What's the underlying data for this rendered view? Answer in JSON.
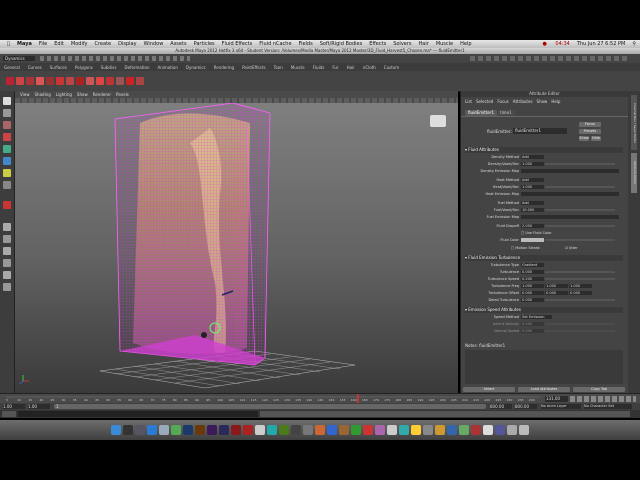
{
  "menubar": {
    "app": "Maya",
    "items": [
      "File",
      "Edit",
      "Modify",
      "Create",
      "Display",
      "Window",
      "Assets",
      "Particles",
      "Fluid Effects",
      "Fluid nCache",
      "Fields",
      "Soft/Rigid Bodies",
      "Effects",
      "Solvers",
      "Hair",
      "Muscle",
      "Help"
    ],
    "clock": "Thu Jun 27 6:52 PM",
    "battery": "04:34"
  },
  "window_title": "Autodesk Maya 2012 Hotfix 3 x64 - Student Version: /Volumes/Media Master/Maya 2012 Master/3D_Fluid_Harvest5_Chosen.ma* --- fluidEmitter1",
  "menu_set": "Dynamics",
  "shelf_tabs": [
    "General",
    "Curves",
    "Surfaces",
    "Polygons",
    "Subdivs",
    "Deformation",
    "Animation",
    "Dynamics",
    "Rendering",
    "PaintEffects",
    "Toon",
    "Muscle",
    "Fluids",
    "Fur",
    "Hair",
    "nCloth",
    "Custom"
  ],
  "viewport_menu": [
    "View",
    "Shading",
    "Lighting",
    "Show",
    "Renderer",
    "Panels"
  ],
  "attribute_editor": {
    "header": "Attribute Editor",
    "menu": [
      "List",
      "Selected",
      "Focus",
      "Attributes",
      "Show",
      "Help"
    ],
    "tabs": [
      "fluidEmitter1",
      "time1"
    ],
    "node_label": "fluidEmitter:",
    "node_value": "fluidEmitter1",
    "buttons": {
      "focus": "Focus",
      "presets": "Presets",
      "show": "Show",
      "hide": "Hide"
    },
    "sections": {
      "fluid": "Fluid Attributes",
      "turbulence": "Fluid Emission Turbulence",
      "speed": "Emission Speed Attributes"
    },
    "fluid_rows": [
      {
        "label": "Density Method",
        "value": "Add"
      },
      {
        "label": "Density/Voxel/Sec",
        "value": "1.000"
      },
      {
        "label": "Density Emission Map",
        "value": ""
      },
      {
        "label": "Heat Method",
        "value": "Add"
      },
      {
        "label": "Heat/Voxel/Sec",
        "value": "1.000"
      },
      {
        "label": "Heat Emission Map",
        "value": ""
      },
      {
        "label": "Fuel Method",
        "value": "Add"
      },
      {
        "label": "Fuel/Voxel/Sec",
        "value": "10.000"
      },
      {
        "label": "Fuel Emission Map",
        "value": ""
      },
      {
        "label": "Fluid Dropoff",
        "value": "2.000"
      }
    ],
    "use_fluid_color": "Use Fluid Color",
    "fluid_color_label": "Fluid Color",
    "motion_streak": "Motion Streak",
    "jitter": "Jitter",
    "turb_rows": [
      {
        "label": "Turbulence Type",
        "value": "Gradient"
      },
      {
        "label": "Turbulence",
        "value": "0.000"
      },
      {
        "label": "Turbulence Speed",
        "value": "0.200"
      },
      {
        "label": "Turbulence Freq",
        "value": "1.000",
        "v2": "1.000",
        "v3": "1.000"
      },
      {
        "label": "Turbulence Offset",
        "value": "0.000",
        "v2": "0.000",
        "v3": "0.000"
      },
      {
        "label": "Detail Turbulence",
        "value": "0.000"
      }
    ],
    "speed_rows": [
      {
        "label": "Speed Method",
        "value": "Set Emission"
      },
      {
        "label": "Inherit Velocity",
        "value": "0.000"
      },
      {
        "label": "Normal Speed",
        "value": "0.000"
      }
    ],
    "notes": "Notes: fluidEmitter1",
    "bottom_buttons": [
      "Select",
      "Load Attributes",
      "Copy Tab"
    ]
  },
  "side_tabs": [
    "Channel Box / Layer Editor",
    "Attribute Editor"
  ],
  "timeslider": {
    "ticks": [
      "5",
      "10",
      "15",
      "20",
      "25",
      "30",
      "35",
      "40",
      "45",
      "50",
      "55",
      "60",
      "65",
      "70",
      "75",
      "80",
      "85",
      "90",
      "95",
      "100",
      "105",
      "110",
      "115",
      "120",
      "125",
      "130",
      "135",
      "140",
      "145",
      "150",
      "155",
      "160",
      "165",
      "170",
      "175",
      "180",
      "185",
      "190",
      "195",
      "200",
      "205",
      "210",
      "215",
      "220",
      "225",
      "230",
      "235",
      "240"
    ],
    "current": "131.00"
  },
  "range": {
    "start": "1.00",
    "inner_start": "1.00",
    "current": "1",
    "end": "800.00",
    "inner_end": "800.00",
    "anim_layer": "No Anim Layer",
    "char_set": "No Character Set"
  }
}
